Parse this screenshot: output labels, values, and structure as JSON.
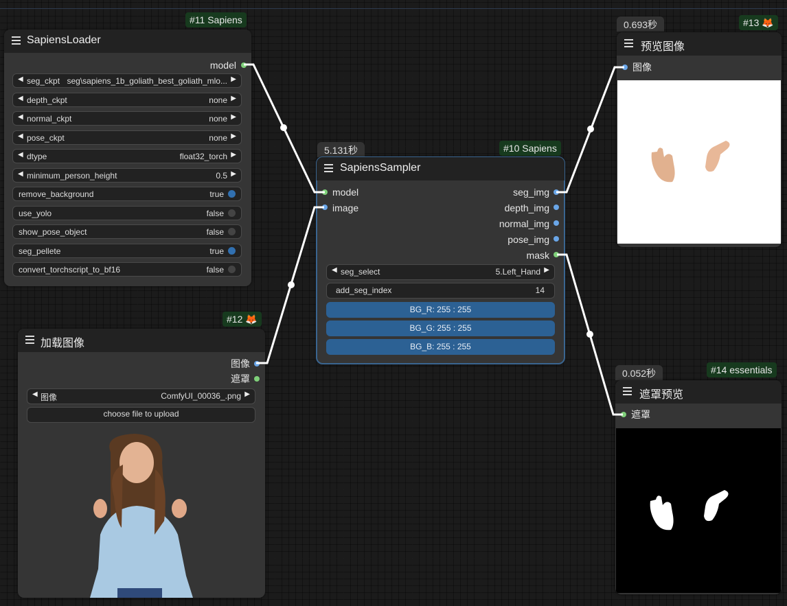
{
  "colors": {
    "background": "#1b1b1b",
    "node": "#353535",
    "header": "#222222",
    "badge": "#173a1e",
    "link": "#ffffff",
    "slot_model": "#7fd07a",
    "slot_image": "#6aa6e8",
    "accent": "#2c6194"
  },
  "loader": {
    "badge": "#11 Sapiens",
    "title": "SapiensLoader",
    "outputs": [
      "model"
    ],
    "widgets": [
      {
        "label": "seg_ckpt",
        "value": "seg\\sapiens_1b_goliath_best_goliath_mlo...",
        "kind": "combo"
      },
      {
        "label": "depth_ckpt",
        "value": "none",
        "kind": "combo"
      },
      {
        "label": "normal_ckpt",
        "value": "none",
        "kind": "combo"
      },
      {
        "label": "pose_ckpt",
        "value": "none",
        "kind": "combo"
      },
      {
        "label": "dtype",
        "value": "float32_torch",
        "kind": "combo"
      },
      {
        "label": "minimum_person_height",
        "value": "0.5",
        "kind": "number"
      },
      {
        "label": "remove_background",
        "value": "true",
        "kind": "toggle"
      },
      {
        "label": "use_yolo",
        "value": "false",
        "kind": "toggle"
      },
      {
        "label": "show_pose_object",
        "value": "false",
        "kind": "toggle"
      },
      {
        "label": "seg_pellete",
        "value": "true",
        "kind": "toggle"
      },
      {
        "label": "convert_torchscript_to_bf16",
        "value": "false",
        "kind": "toggle"
      }
    ]
  },
  "load_image": {
    "badge": "#12 🦊",
    "title": "加载图像",
    "outputs": [
      "图像",
      "遮罩"
    ],
    "image_widget": {
      "label": "图像",
      "value": "ComfyUI_00036_.png"
    },
    "upload_label": "choose file to upload"
  },
  "sampler": {
    "timer": "5.131秒",
    "badge": "#10 Sapiens",
    "title": "SapiensSampler",
    "inputs": [
      "model",
      "image"
    ],
    "outputs": [
      "seg_img",
      "depth_img",
      "normal_img",
      "pose_img",
      "mask"
    ],
    "seg_select": {
      "label": "seg_select",
      "value": "5.Left_Hand"
    },
    "add_seg_index": {
      "label": "add_seg_index",
      "value": "14"
    },
    "bg": [
      "BG_R: 255 : 255",
      "BG_G: 255 : 255",
      "BG_B: 255 : 255"
    ]
  },
  "preview": {
    "timer": "0.693秒",
    "badge": "#13 🦊",
    "title": "预览图像",
    "input": "图像"
  },
  "mask_preview": {
    "timer": "0.052秒",
    "badge": "#14 essentials",
    "title": "遮罩预览",
    "input": "遮罩"
  }
}
